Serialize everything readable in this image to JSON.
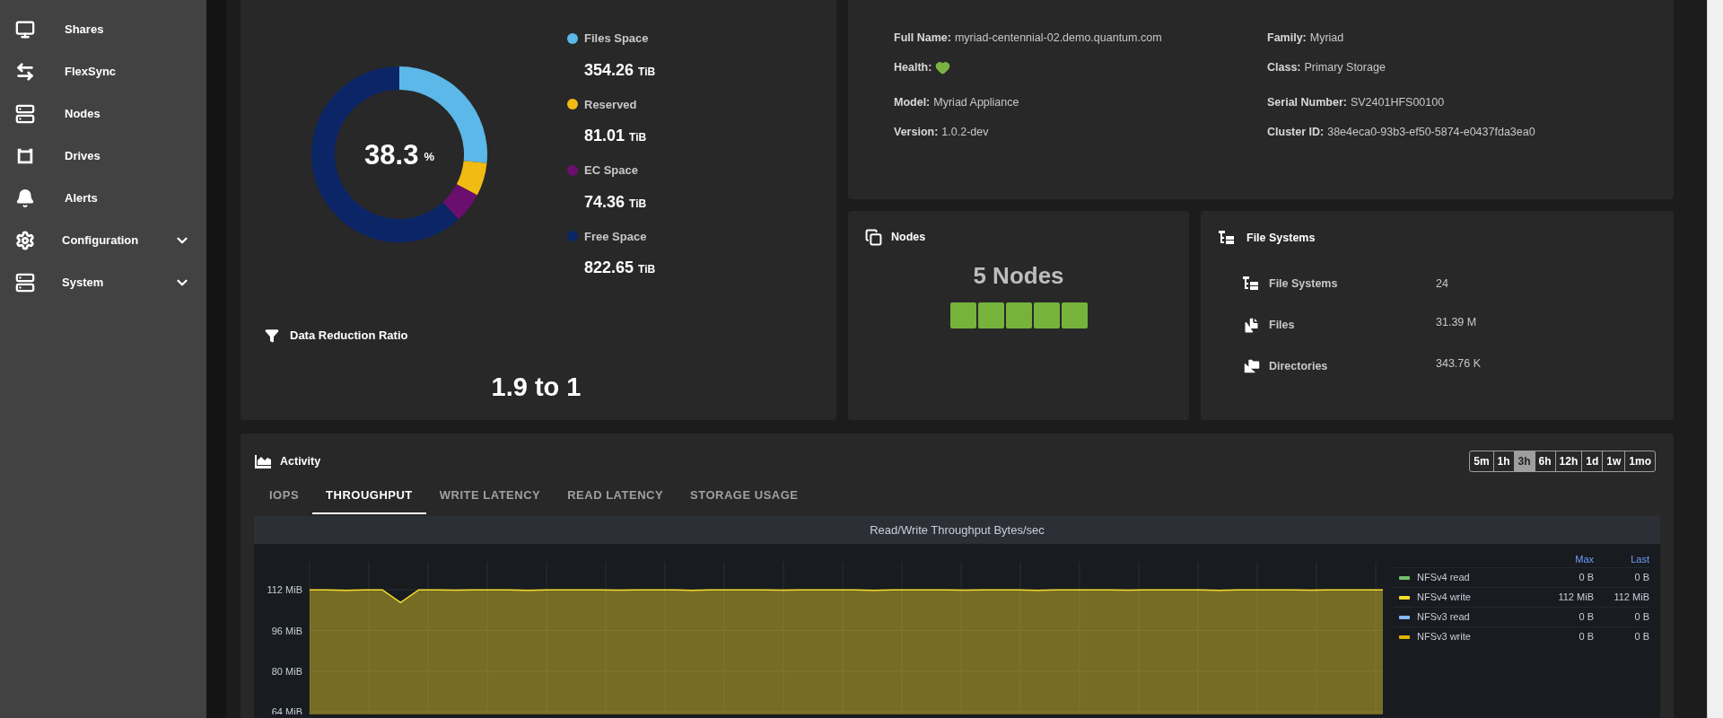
{
  "sidebar": {
    "items": [
      {
        "kind": "link",
        "label": "Shares"
      },
      {
        "kind": "link",
        "label": "FlexSync"
      },
      {
        "kind": "link",
        "label": "Nodes"
      },
      {
        "kind": "link",
        "label": "Drives"
      },
      {
        "kind": "link",
        "label": "Alerts"
      },
      {
        "kind": "group",
        "label": "Configuration",
        "expanded": false
      },
      {
        "kind": "group",
        "label": "System",
        "expanded": false
      }
    ]
  },
  "capacity": {
    "center_value": "38.3",
    "center_unit": "%",
    "legend": [
      {
        "label": "Files Space",
        "value": "354.26",
        "unit": "TiB",
        "color": "#5bb8e8"
      },
      {
        "label": "Reserved",
        "value": "81.01",
        "unit": "TiB",
        "color": "#f2bb13"
      },
      {
        "label": "EC Space",
        "value": "74.36",
        "unit": "TiB",
        "color": "#6b0f6e"
      },
      {
        "label": "Free Space",
        "value": "822.65",
        "unit": "TiB",
        "color": "#0c2566"
      }
    ],
    "reduction": {
      "title": "Data Reduction Ratio",
      "value": "1.9 to 1"
    }
  },
  "system_info": {
    "columns": [
      [
        {
          "kind": "text",
          "label": "Full Name:",
          "value": "myriad-centennial-02.demo.quantum.com"
        },
        {
          "kind": "status",
          "label": "Health:",
          "healthy": true
        },
        {
          "kind": "text",
          "label": "Model:",
          "value": "Myriad Appliance"
        },
        {
          "kind": "text",
          "label": "Version:",
          "value": "1.0.2-dev"
        }
      ],
      [
        {
          "kind": "text",
          "label": "Family:",
          "value": "Myriad"
        },
        {
          "kind": "text",
          "label": "Class:",
          "value": "Primary Storage"
        },
        {
          "kind": "text",
          "label": "Serial Number:",
          "value": "SV2401HFS00100"
        },
        {
          "kind": "text",
          "label": "Cluster ID:",
          "value": "38e4eca0-93b3-ef50-5874-e0437fda3ea0"
        }
      ]
    ]
  },
  "nodes": {
    "title": "Nodes",
    "summary": "5 Nodes",
    "items": [
      {
        "color": "#76b33a"
      },
      {
        "color": "#76b33a"
      },
      {
        "color": "#76b33a"
      },
      {
        "color": "#76b33a"
      },
      {
        "color": "#76b33a"
      }
    ]
  },
  "file_systems": {
    "title": "File Systems",
    "rows": [
      {
        "label": "File Systems",
        "value": "24"
      },
      {
        "label": "Files",
        "value": "31.39 M"
      },
      {
        "label": "Directories",
        "value": "343.76 K"
      }
    ]
  },
  "activity": {
    "title": "Activity",
    "ranges": [
      {
        "label": "5m",
        "selected": false
      },
      {
        "label": "1h",
        "selected": false
      },
      {
        "label": "3h",
        "selected": true
      },
      {
        "label": "6h",
        "selected": false
      },
      {
        "label": "12h",
        "selected": false
      },
      {
        "label": "1d",
        "selected": false
      },
      {
        "label": "1w",
        "selected": false
      },
      {
        "label": "1mo",
        "selected": false
      }
    ],
    "tabs": [
      {
        "label": "IOPS",
        "selected": false
      },
      {
        "label": "THROUGHPUT",
        "selected": true
      },
      {
        "label": "WRITE LATENCY",
        "selected": false
      },
      {
        "label": "READ LATENCY",
        "selected": false
      },
      {
        "label": "STORAGE USAGE",
        "selected": false
      }
    ],
    "chart_title": "Read/Write Throughput Bytes/sec",
    "legend_columns": [
      "Max",
      "Last"
    ],
    "legend": [
      {
        "name": "NFSv4 read",
        "color": "#73bf69",
        "max": "0 B",
        "last": "0 B"
      },
      {
        "name": "NFSv4 write",
        "color": "#fade2a",
        "max": "112 MiB",
        "last": "112 MiB"
      },
      {
        "name": "NFSv3 read",
        "color": "#8ab8ff",
        "max": "0 B",
        "last": "0 B"
      },
      {
        "name": "NFSv3 write",
        "color": "#e0b400",
        "max": "0 B",
        "last": "0 B"
      }
    ],
    "chart_data": {
      "type": "area",
      "grid": true,
      "ylim": [
        63,
        123
      ],
      "yticks": [
        {
          "value": 64,
          "label": "64 MiB"
        },
        {
          "value": 80,
          "label": "80 MiB"
        },
        {
          "value": 96,
          "label": "96 MiB"
        },
        {
          "value": 112,
          "label": "112 MiB"
        }
      ],
      "series": [
        {
          "color": "#fade2a",
          "values": [
            112,
            112,
            111.8,
            112,
            112,
            107,
            112,
            112,
            111.9,
            112,
            112,
            112,
            111.8,
            112,
            112,
            112,
            112,
            111.9,
            112,
            112,
            112,
            111.8,
            112,
            112,
            112,
            112,
            111.9,
            112,
            112,
            112,
            112,
            111.8,
            112,
            112,
            112,
            112,
            111.9,
            112,
            112,
            112,
            111.8,
            112,
            112,
            112,
            112,
            111.9,
            112,
            112,
            112,
            112,
            111.8,
            112,
            112,
            112,
            112,
            111.9,
            112,
            112,
            112,
            112
          ]
        }
      ]
    }
  }
}
